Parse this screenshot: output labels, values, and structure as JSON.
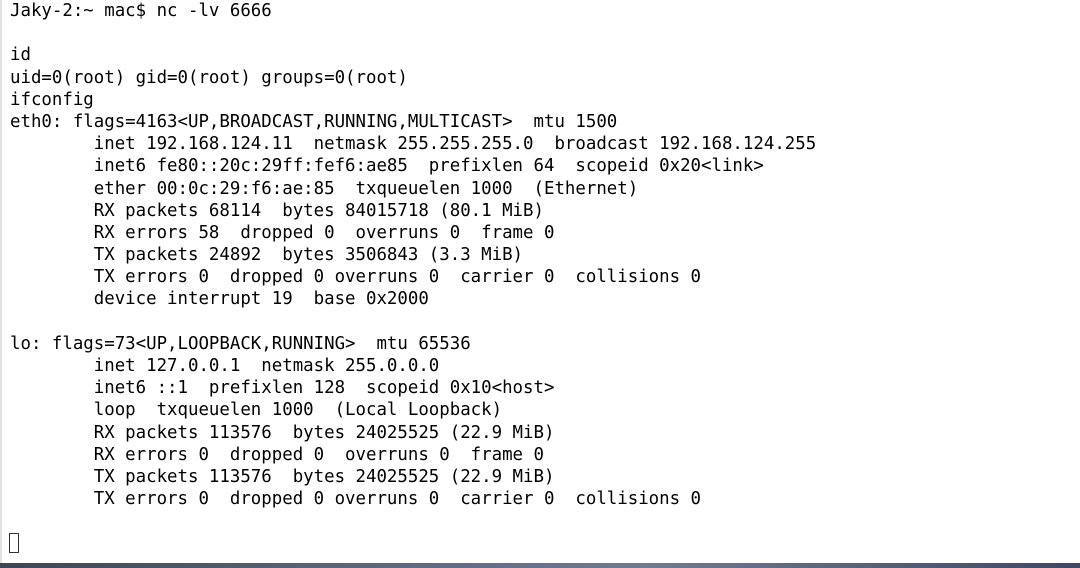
{
  "terminal": {
    "lines": [
      "Jaky-2:~ mac$ nc -lv 6666",
      "",
      "id",
      "uid=0(root) gid=0(root) groups=0(root)",
      "ifconfig",
      "eth0: flags=4163<UP,BROADCAST,RUNNING,MULTICAST>  mtu 1500",
      "        inet 192.168.124.11  netmask 255.255.255.0  broadcast 192.168.124.255",
      "        inet6 fe80::20c:29ff:fef6:ae85  prefixlen 64  scopeid 0x20<link>",
      "        ether 00:0c:29:f6:ae:85  txqueuelen 1000  (Ethernet)",
      "        RX packets 68114  bytes 84015718 (80.1 MiB)",
      "        RX errors 58  dropped 0  overruns 0  frame 0",
      "        TX packets 24892  bytes 3506843 (3.3 MiB)",
      "        TX errors 0  dropped 0 overruns 0  carrier 0  collisions 0",
      "        device interrupt 19  base 0x2000",
      "",
      "lo: flags=73<UP,LOOPBACK,RUNNING>  mtu 65536",
      "        inet 127.0.0.1  netmask 255.0.0.0",
      "        inet6 ::1  prefixlen 128  scopeid 0x10<host>",
      "        loop  txqueuelen 1000  (Local Loopback)",
      "        RX packets 113576  bytes 24025525 (22.9 MiB)",
      "        RX errors 0  dropped 0  overruns 0  frame 0",
      "        TX packets 113576  bytes 24025525 (22.9 MiB)",
      "        TX errors 0  dropped 0 overruns 0  carrier 0  collisions 0"
    ]
  },
  "colors": {
    "background": "#ffffff",
    "text": "#000000"
  },
  "icons": {
    "cursor": "block-cursor-icon"
  }
}
